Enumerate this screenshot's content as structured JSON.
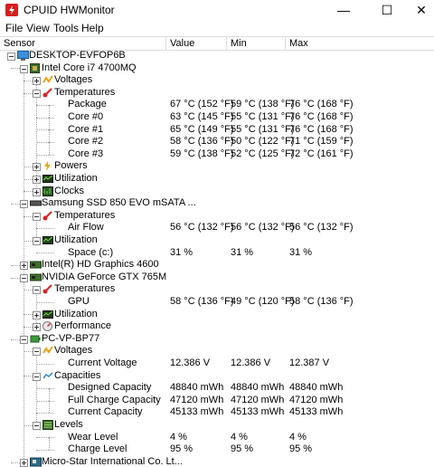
{
  "window": {
    "title": "CPUID HWMonitor",
    "minimize_glyph": "—",
    "maximize_glyph": "☐",
    "close_glyph": "✕"
  },
  "menu": [
    "File",
    "View",
    "Tools",
    "Help"
  ],
  "columns": [
    "Sensor",
    "Value",
    "Min",
    "Max"
  ],
  "tree": [
    {
      "level": 0,
      "expander": "minus",
      "icon": "computer-icon",
      "label": "DESKTOP-EVFOP6B"
    },
    {
      "level": 1,
      "expander": "minus",
      "icon": "cpu-icon",
      "label": "Intel Core i7 4700MQ"
    },
    {
      "level": 2,
      "expander": "plus",
      "icon": "voltage-icon",
      "label": "Voltages"
    },
    {
      "level": 2,
      "expander": "minus",
      "icon": "temperature-icon",
      "label": "Temperatures"
    },
    {
      "level": 3,
      "label": "Package",
      "value": "67 °C  (152 °F)",
      "min": "59 °C  (138 °F)",
      "max": "76 °C  (168 °F)"
    },
    {
      "level": 3,
      "label": "Core #0",
      "value": "63 °C  (145 °F)",
      "min": "55 °C  (131 °F)",
      "max": "76 °C  (168 °F)"
    },
    {
      "level": 3,
      "label": "Core #1",
      "value": "65 °C  (149 °F)",
      "min": "55 °C  (131 °F)",
      "max": "76 °C  (168 °F)"
    },
    {
      "level": 3,
      "label": "Core #2",
      "value": "58 °C  (136 °F)",
      "min": "50 °C  (122 °F)",
      "max": "71 °C  (159 °F)"
    },
    {
      "level": 3,
      "label": "Core #3",
      "value": "59 °C  (138 °F)",
      "min": "52 °C  (125 °F)",
      "max": "72 °C  (161 °F)"
    },
    {
      "level": 2,
      "expander": "plus",
      "icon": "power-icon",
      "label": "Powers"
    },
    {
      "level": 2,
      "expander": "plus",
      "icon": "utilization-icon",
      "label": "Utilization"
    },
    {
      "level": 2,
      "expander": "plus",
      "icon": "clock-icon",
      "label": "Clocks"
    },
    {
      "level": 1,
      "expander": "minus",
      "icon": "ssd-icon",
      "label": "Samsung SSD 850 EVO mSATA ..."
    },
    {
      "level": 2,
      "expander": "minus",
      "icon": "temperature-icon",
      "label": "Temperatures"
    },
    {
      "level": 3,
      "label": "Air Flow",
      "value": "56 °C  (132 °F)",
      "min": "56 °C  (132 °F)",
      "max": "56 °C  (132 °F)"
    },
    {
      "level": 2,
      "expander": "minus",
      "icon": "utilization-icon",
      "label": "Utilization"
    },
    {
      "level": 3,
      "label": "Space (c:)",
      "value": "31 %",
      "min": "31 %",
      "max": "31 %"
    },
    {
      "level": 1,
      "expander": "plus",
      "icon": "gpu-icon",
      "label": "Intel(R) HD Graphics 4600"
    },
    {
      "level": 1,
      "expander": "minus",
      "icon": "gpu-icon",
      "label": "NVIDIA GeForce GTX 765M"
    },
    {
      "level": 2,
      "expander": "minus",
      "icon": "temperature-icon",
      "label": "Temperatures"
    },
    {
      "level": 3,
      "label": "GPU",
      "value": "58 °C  (136 °F)",
      "min": "49 °C  (120 °F)",
      "max": "58 °C  (136 °F)"
    },
    {
      "level": 2,
      "expander": "plus",
      "icon": "utilization-icon",
      "label": "Utilization"
    },
    {
      "level": 2,
      "expander": "plus",
      "icon": "performance-icon",
      "label": "Performance"
    },
    {
      "level": 1,
      "expander": "minus",
      "icon": "battery-icon",
      "label": "PC-VP-BP77"
    },
    {
      "level": 2,
      "expander": "minus",
      "icon": "voltage-icon",
      "label": "Voltages"
    },
    {
      "level": 3,
      "label": "Current Voltage",
      "value": "12.386 V",
      "min": "12.386 V",
      "max": "12.387 V"
    },
    {
      "level": 2,
      "expander": "minus",
      "icon": "capacity-icon",
      "label": "Capacities"
    },
    {
      "level": 3,
      "label": "Designed Capacity",
      "value": "48840 mWh",
      "min": "48840 mWh",
      "max": "48840 mWh"
    },
    {
      "level": 3,
      "label": "Full Charge Capacity",
      "value": "47120 mWh",
      "min": "47120 mWh",
      "max": "47120 mWh"
    },
    {
      "level": 3,
      "label": "Current Capacity",
      "value": "45133 mWh",
      "min": "45133 mWh",
      "max": "45133 mWh"
    },
    {
      "level": 2,
      "expander": "minus",
      "icon": "levels-icon",
      "label": "Levels"
    },
    {
      "level": 3,
      "label": "Wear Level",
      "value": "4 %",
      "min": "4 %",
      "max": "4 %"
    },
    {
      "level": 3,
      "label": "Charge Level",
      "value": "95 %",
      "min": "95 %",
      "max": "95 %"
    },
    {
      "level": 1,
      "expander": "plus",
      "icon": "motherboard-icon",
      "label": "Micro-Star International Co. Lt..."
    }
  ],
  "colors": {
    "app_icon": "#d51e1e",
    "voltage": "#e8a317",
    "temperature": "#d62424",
    "chip": "#3c6e2a",
    "monitor": "#3a8fd8"
  }
}
